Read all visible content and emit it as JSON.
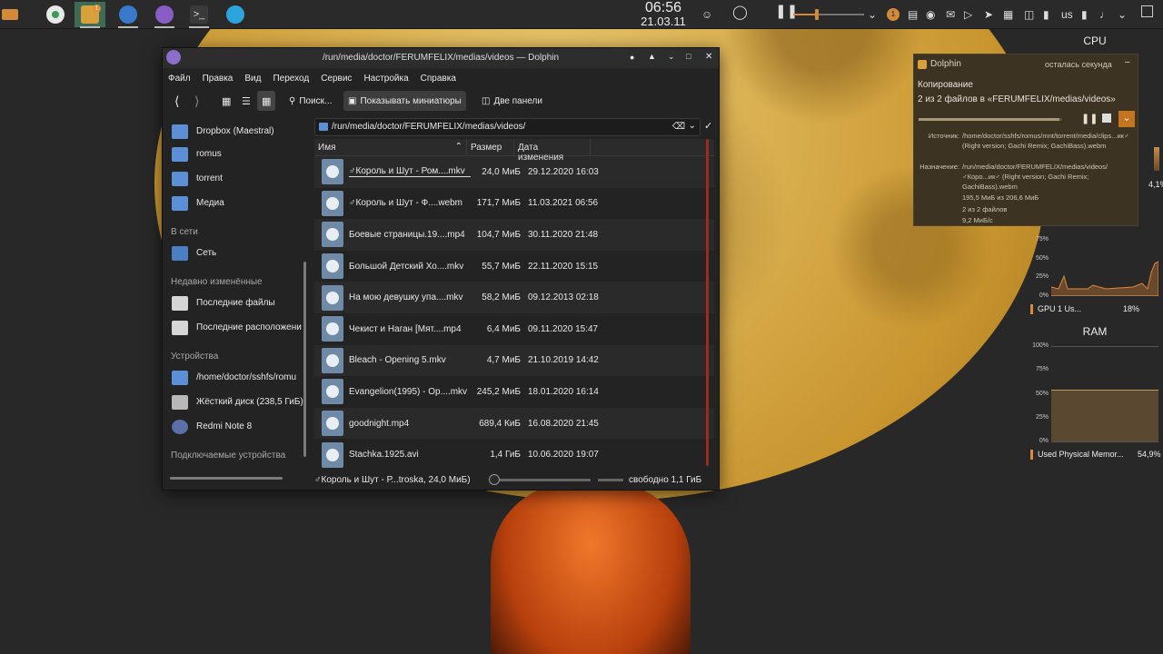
{
  "panel": {
    "tasks": [
      "app-launcher",
      "folder-badge",
      "globe",
      "media-player",
      "terminal",
      "telegram"
    ],
    "badge_count": "1",
    "clock_time": "06:56",
    "clock_date": "21.03.11",
    "tray_badge": "1",
    "keyboard_layout": "us"
  },
  "dolphin": {
    "title": "/run/media/doctor/FERUMFELIX/medias/videos — Dolphin",
    "menu": [
      "Файл",
      "Правка",
      "Вид",
      "Переход",
      "Сервис",
      "Настройка",
      "Справка"
    ],
    "toolbar": {
      "search": "Поиск...",
      "thumbnails": "Показывать миниатюры",
      "split": "Две панели"
    },
    "places": {
      "items_top": [
        "Dropbox (Maestral)",
        "romus",
        "torrent",
        "Медиа"
      ],
      "section_network": "В сети",
      "network": [
        "Сеть"
      ],
      "section_recent": "Недавно изменённые",
      "recent": [
        "Последние файлы",
        "Последние расположени"
      ],
      "section_devices": "Устройства",
      "devices": [
        "/home/doctor/sshfs/romu",
        "Жёсткий диск (238,5 ГиБ)",
        "Redmi Note 8"
      ],
      "section_removable": "Подключаемые устройства"
    },
    "address": "/run/media/doctor/FERUMFELIX/medias/videos/",
    "columns": {
      "name": "Имя",
      "size": "Размер",
      "date": "Дата изменения"
    },
    "files": [
      {
        "name": "♂Король и Шут - Ром....mkv",
        "size": "24,0 МиБ",
        "date": "29.12.2020 16:03"
      },
      {
        "name": "♂Король и Шут - Ф....webm",
        "size": "171,7 МиБ",
        "date": "11.03.2021 06:56"
      },
      {
        "name": "Боевые страницы.19....mp4",
        "size": "104,7 МиБ",
        "date": "30.11.2020 21:48"
      },
      {
        "name": "Большой Детский Хо....mkv",
        "size": "55,7 МиБ",
        "date": "22.11.2020 15:15"
      },
      {
        "name": "На мою девушку упа....mkv",
        "size": "58,2 МиБ",
        "date": "09.12.2013 02:18"
      },
      {
        "name": "Чекист и Наган [Мят....mp4",
        "size": "6,4 МиБ",
        "date": "09.11.2020 15:47"
      },
      {
        "name": "Bleach - Opening 5.mkv",
        "size": "4,7 МиБ",
        "date": "21.10.2019 14:42"
      },
      {
        "name": "Evangelion(1995) - Op....mkv",
        "size": "245,2 МиБ",
        "date": "18.01.2020 16:14"
      },
      {
        "name": "goodnight.mp4",
        "size": "689,4 КиБ",
        "date": "16.08.2020 21:45"
      },
      {
        "name": "Stachka.1925.avi",
        "size": "1,4 ГиБ",
        "date": "10.06.2020 19:07"
      }
    ],
    "status_selected": "♂Король и Шут - Р...troska, 24,0 МиБ)",
    "status_free": "свободно 1,1 ГиБ"
  },
  "notification": {
    "app": "Dolphin",
    "remaining": "осталась секунда",
    "heading": "Копирование",
    "summary": "2 из 2 файлов в «FERUMFELIX/medias/videos»",
    "progress": 0.98,
    "source_label": "Источник:",
    "source_value": "/home/doctor/sshfs/romus/mnt/torrent/media/clips...ик♂ (Right version; Gachi Remix; GachiBass).webm",
    "dest_label": "Назначение:",
    "dest_value": "/run/media/doctor/FERUMFELIX/medias/videos/♂Коро...ик♂ (Right version; Gachi Remix; GachiBass).webm",
    "bytes": "195,5 МиБ из 206,6 МиБ",
    "files": "2 из 2 файлов",
    "speed": "9,2 МиБ/с"
  },
  "sysmon": {
    "cpu_title": "CPU",
    "cpu_value": "4,1%",
    "gpu_axis": [
      "75%",
      "50%",
      "25%",
      "0%"
    ],
    "gpu_label": "GPU 1 Us...",
    "gpu_value": "18%",
    "ram_title": "RAM",
    "ram_axis": [
      "100%",
      "75%",
      "50%",
      "25%",
      "0%"
    ],
    "ram_label": "Used Physical Memor...",
    "ram_value": "54,9%",
    "accent": "#e0873a"
  }
}
